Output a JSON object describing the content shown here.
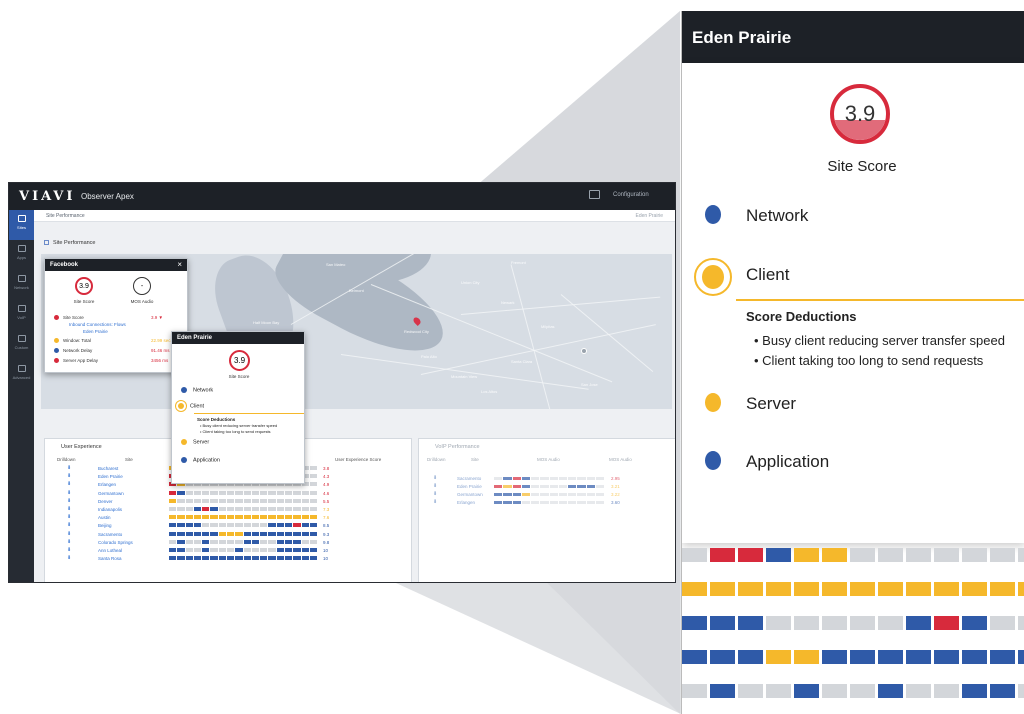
{
  "app": {
    "brand": "VIAVI",
    "title": "Observer Apex",
    "config_label": "Configuration",
    "sidebar": [
      {
        "label": "Sites",
        "icon": "sites-icon"
      },
      {
        "label": "Apps",
        "icon": "apps-icon"
      },
      {
        "label": "Network",
        "icon": "network-icon"
      },
      {
        "label": "VoIP",
        "icon": "phone-icon"
      },
      {
        "label": "Custom",
        "icon": "custom-icon"
      },
      {
        "label": "Advanced",
        "icon": "advanced-icon"
      }
    ],
    "breadcrumb": "Site Performance",
    "location": "Eden Prairie",
    "section_title": "Site Performance",
    "map_labels": [
      "San Mateo",
      "Fremont",
      "Belmont",
      "Union City",
      "Redwood City",
      "Milpitas",
      "Mountain View",
      "San Jose",
      "Palo Alto",
      "Half Moon Bay",
      "Santa Clara",
      "Los Altos",
      "Newark"
    ]
  },
  "facebook_popup": {
    "title": "Facebook",
    "site_score": "3.9",
    "site_score_label": "Site Score",
    "mos_value": "-",
    "mos_label": "MOS Audio",
    "rows": [
      {
        "label": "Site Score",
        "value": "3.9 ▼",
        "color": "#d72a3c"
      },
      {
        "label": "Inbound Connections: Flows",
        "value": ""
      },
      {
        "label": "Eden Prairie",
        "value": ""
      },
      {
        "label": "Window: Total",
        "value": "22.99 sec",
        "color": "#f5b82b"
      },
      {
        "label": "Network Delay",
        "value": "91.46 ms",
        "color": "#2f5aa8"
      },
      {
        "label": "Server App Delay",
        "value": "3456 ms",
        "color": "#d72a3c"
      }
    ]
  },
  "eden_popup_small": {
    "title": "Eden Prairie",
    "score": "3.9",
    "score_label": "Site Score",
    "items": [
      "Network",
      "Client",
      "Server",
      "Application"
    ],
    "deductions_title": "Score Deductions",
    "deductions": [
      "Busy client reducing server transfer speed",
      "Client taking too long to send requests"
    ]
  },
  "user_experience": {
    "title": "User Experience",
    "columns": [
      "Drilldown",
      "Site",
      "User Experience Score"
    ],
    "rows": [
      {
        "site": "Bucharest",
        "score": "3.8"
      },
      {
        "site": "Eden Prairie",
        "score": "4.3"
      },
      {
        "site": "Erlangen",
        "score": "4.9"
      },
      {
        "site": "Germantown",
        "score": "4.6"
      },
      {
        "site": "Denver",
        "score": "5.5"
      },
      {
        "site": "Indianapolis",
        "score": "7.3"
      },
      {
        "site": "Austin",
        "score": "7.6"
      },
      {
        "site": "Beijing",
        "score": "8.5"
      },
      {
        "site": "Sacramento",
        "score": "9.3"
      },
      {
        "site": "Colorado Springs",
        "score": "9.8"
      },
      {
        "site": "Ann Lotheal",
        "score": "10"
      },
      {
        "site": "Santa Rosa",
        "score": "10"
      }
    ]
  },
  "voip": {
    "title": "VoIP Performance",
    "columns": [
      "Drilldown",
      "Site",
      "MOS Audio",
      "MOS Audio"
    ],
    "rows": [
      {
        "site": "Sacramento",
        "score": "2.95"
      },
      {
        "site": "Eden Prairie",
        "score": "3.21"
      },
      {
        "site": "Germantown",
        "score": "3.22"
      },
      {
        "site": "Erlangen",
        "score": "3.60"
      }
    ]
  },
  "zoom": {
    "title": "Eden Prairie",
    "score": "3.9",
    "score_fraction": 0.39,
    "score_label": "Site Score",
    "items": [
      {
        "label": "Network",
        "color": "#2f5aa8"
      },
      {
        "label": "Client",
        "color": "#f5b82b"
      },
      {
        "label": "Server",
        "color": "#f5b82b"
      },
      {
        "label": "Application",
        "color": "#2f5aa8"
      }
    ],
    "deductions_title": "Score Deductions",
    "deductions": [
      "Busy client reducing server transfer speed",
      "Client taking too long to send requests"
    ]
  },
  "colors": {
    "red": "#d72a3c",
    "yellow": "#f5b82b",
    "blue": "#2f5aa8",
    "grey": "#d3d6da",
    "dark": "#1d2127"
  }
}
